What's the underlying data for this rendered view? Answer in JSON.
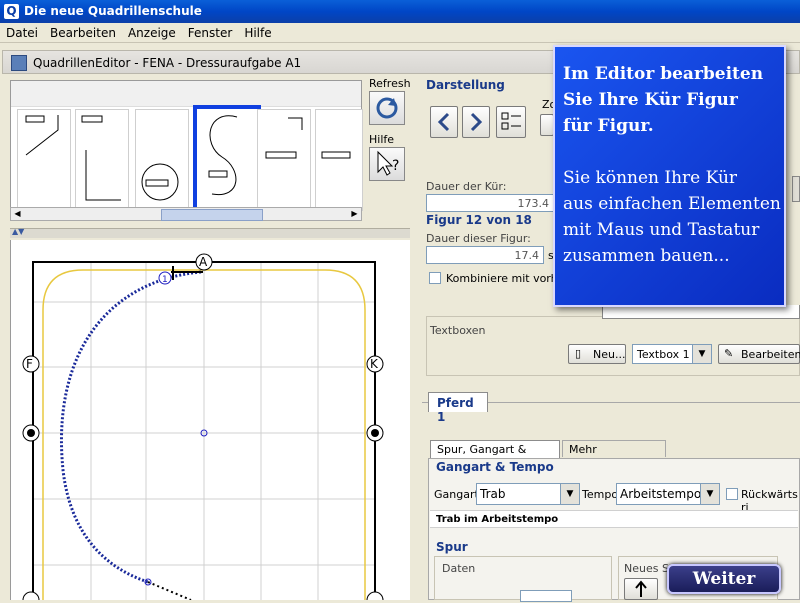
{
  "window": {
    "title": "Die neue Quadrillenschule",
    "icon": "Q"
  },
  "menu": [
    "Datei",
    "Bearbeiten",
    "Anzeige",
    "Fenster",
    "Hilfe"
  ],
  "editor": {
    "title": "QuadrillenEditor - FENA - Dressuraufgabe A1"
  },
  "side": {
    "refresh": "Refresh",
    "hilfe": "Hilfe"
  },
  "arena": {
    "letters": {
      "top": "A",
      "left": "F",
      "right": "K"
    },
    "marker": "1"
  },
  "darstellung": {
    "label": "Darstellung",
    "zoom_label": "Zo"
  },
  "kuer": {
    "dauer_label": "Dauer der Kür:",
    "dauer_value": "173.4"
  },
  "figur": {
    "title": "Figur 12 von 18",
    "dauer_label": "Dauer dieser Figur:",
    "dauer_value": "17.4",
    "unit": "s",
    "kombiniere": "Kombiniere mit vorheri"
  },
  "textboxen": {
    "label": "Textboxen",
    "neu": "Neu...",
    "select": "Textbox 1",
    "bearbeiten": "Bearbeiten..."
  },
  "pferd": {
    "tab": "Pferd 1",
    "subtabs": [
      "Spur, Gangart & Tempo",
      "Mehr Einstellungen"
    ]
  },
  "gangart_tempo": {
    "label": "Gangart & Tempo",
    "gangart_label": "Gangart:",
    "gangart_value": "Trab",
    "tempo_label": "Tempo:",
    "tempo_value": "Arbeitstempo",
    "rueckwaerts": "Rückwärts ri",
    "summary": "Trab im Arbeitstempo"
  },
  "spur": {
    "label": "Spur",
    "daten": "Daten",
    "neues": "Neues Sp"
  },
  "overlay": {
    "lines1": [
      "Im Editor bearbeiten",
      "Sie Ihre Kür Figur",
      "für Figur."
    ],
    "lines2": [
      "Sie können Ihre Kür",
      "aus einfachen Elementen",
      "mit Maus und Tastatur",
      "zusammen bauen..."
    ]
  },
  "weiter": "Weiter",
  "colors": {
    "titlebar": "#0a4fd0",
    "selection": "#1040e0",
    "overlay": "#1a4fe8",
    "path": "#1a2a9a",
    "arena_border": "#e8c840"
  }
}
